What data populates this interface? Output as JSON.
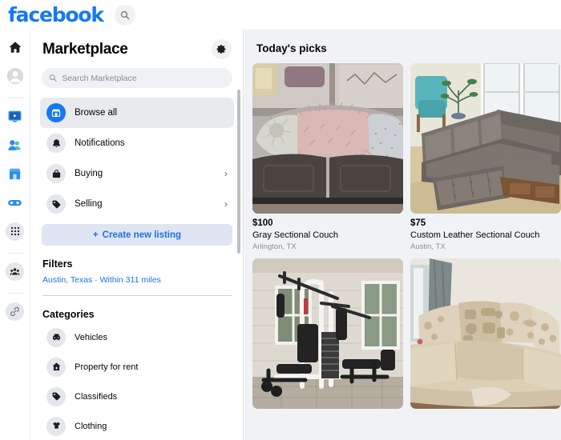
{
  "header": {
    "brand": "facebook",
    "search_icon": "search-icon"
  },
  "rail": {
    "items": [
      {
        "name": "home-icon",
        "label": "Home"
      },
      {
        "name": "profile-avatar-icon",
        "label": "Profile"
      },
      {
        "name": "watch-icon",
        "label": "Watch"
      },
      {
        "name": "friends-icon",
        "label": "Friends"
      },
      {
        "name": "marketplace-icon",
        "label": "Marketplace"
      },
      {
        "name": "gaming-icon",
        "label": "Gaming"
      },
      {
        "name": "menu-grid-icon",
        "label": "All shortcuts"
      },
      {
        "name": "groups-icon",
        "label": "Groups"
      },
      {
        "name": "link-icon",
        "label": "Links"
      }
    ]
  },
  "panel": {
    "title": "Marketplace",
    "settings_icon": "gear-icon",
    "search": {
      "placeholder": "Search Marketplace",
      "value": "",
      "icon": "search-icon"
    },
    "nav": [
      {
        "label": "Browse all",
        "icon": "storefront-icon",
        "active": true,
        "chevron": ""
      },
      {
        "label": "Notifications",
        "icon": "bell-icon",
        "active": false,
        "chevron": ""
      },
      {
        "label": "Buying",
        "icon": "shopping-bag-icon",
        "active": false,
        "chevron": "›"
      },
      {
        "label": "Selling",
        "icon": "price-tag-icon",
        "active": false,
        "chevron": "›"
      }
    ],
    "create_button": {
      "label": "Create new listing",
      "plus": "+"
    },
    "filters": {
      "title": "Filters",
      "value": "Austin, Texas · Within 311 miles"
    },
    "categories": {
      "title": "Categories",
      "items": [
        {
          "label": "Vehicles",
          "icon": "car-icon"
        },
        {
          "label": "Property for rent",
          "icon": "house-icon"
        },
        {
          "label": "Classifieds",
          "icon": "price-tag-icon"
        },
        {
          "label": "Clothing",
          "icon": "tshirt-icon"
        }
      ]
    }
  },
  "main": {
    "title": "Today's picks",
    "listings": [
      {
        "price": "$100",
        "title": "Gray Sectional Couch",
        "location": "Arlington, TX",
        "image": "gray-sectional-couch-photo"
      },
      {
        "price": "$75",
        "title": "Custom Leather Sectional Couch",
        "location": "Austin, TX",
        "image": "leather-sectional-couch-photo"
      },
      {
        "price": "",
        "title": "",
        "location": "",
        "image": "home-gym-machine-photo"
      },
      {
        "price": "",
        "title": "",
        "location": "",
        "image": "beige-sectional-couch-photo"
      }
    ]
  },
  "colors": {
    "brand_blue": "#1877f2",
    "link_blue": "#1b74e4",
    "create_bg": "#dfe5f2",
    "panel_bg": "#ffffff",
    "content_bg": "#f0f2f5",
    "active_nav_bg": "#e8eaee"
  }
}
